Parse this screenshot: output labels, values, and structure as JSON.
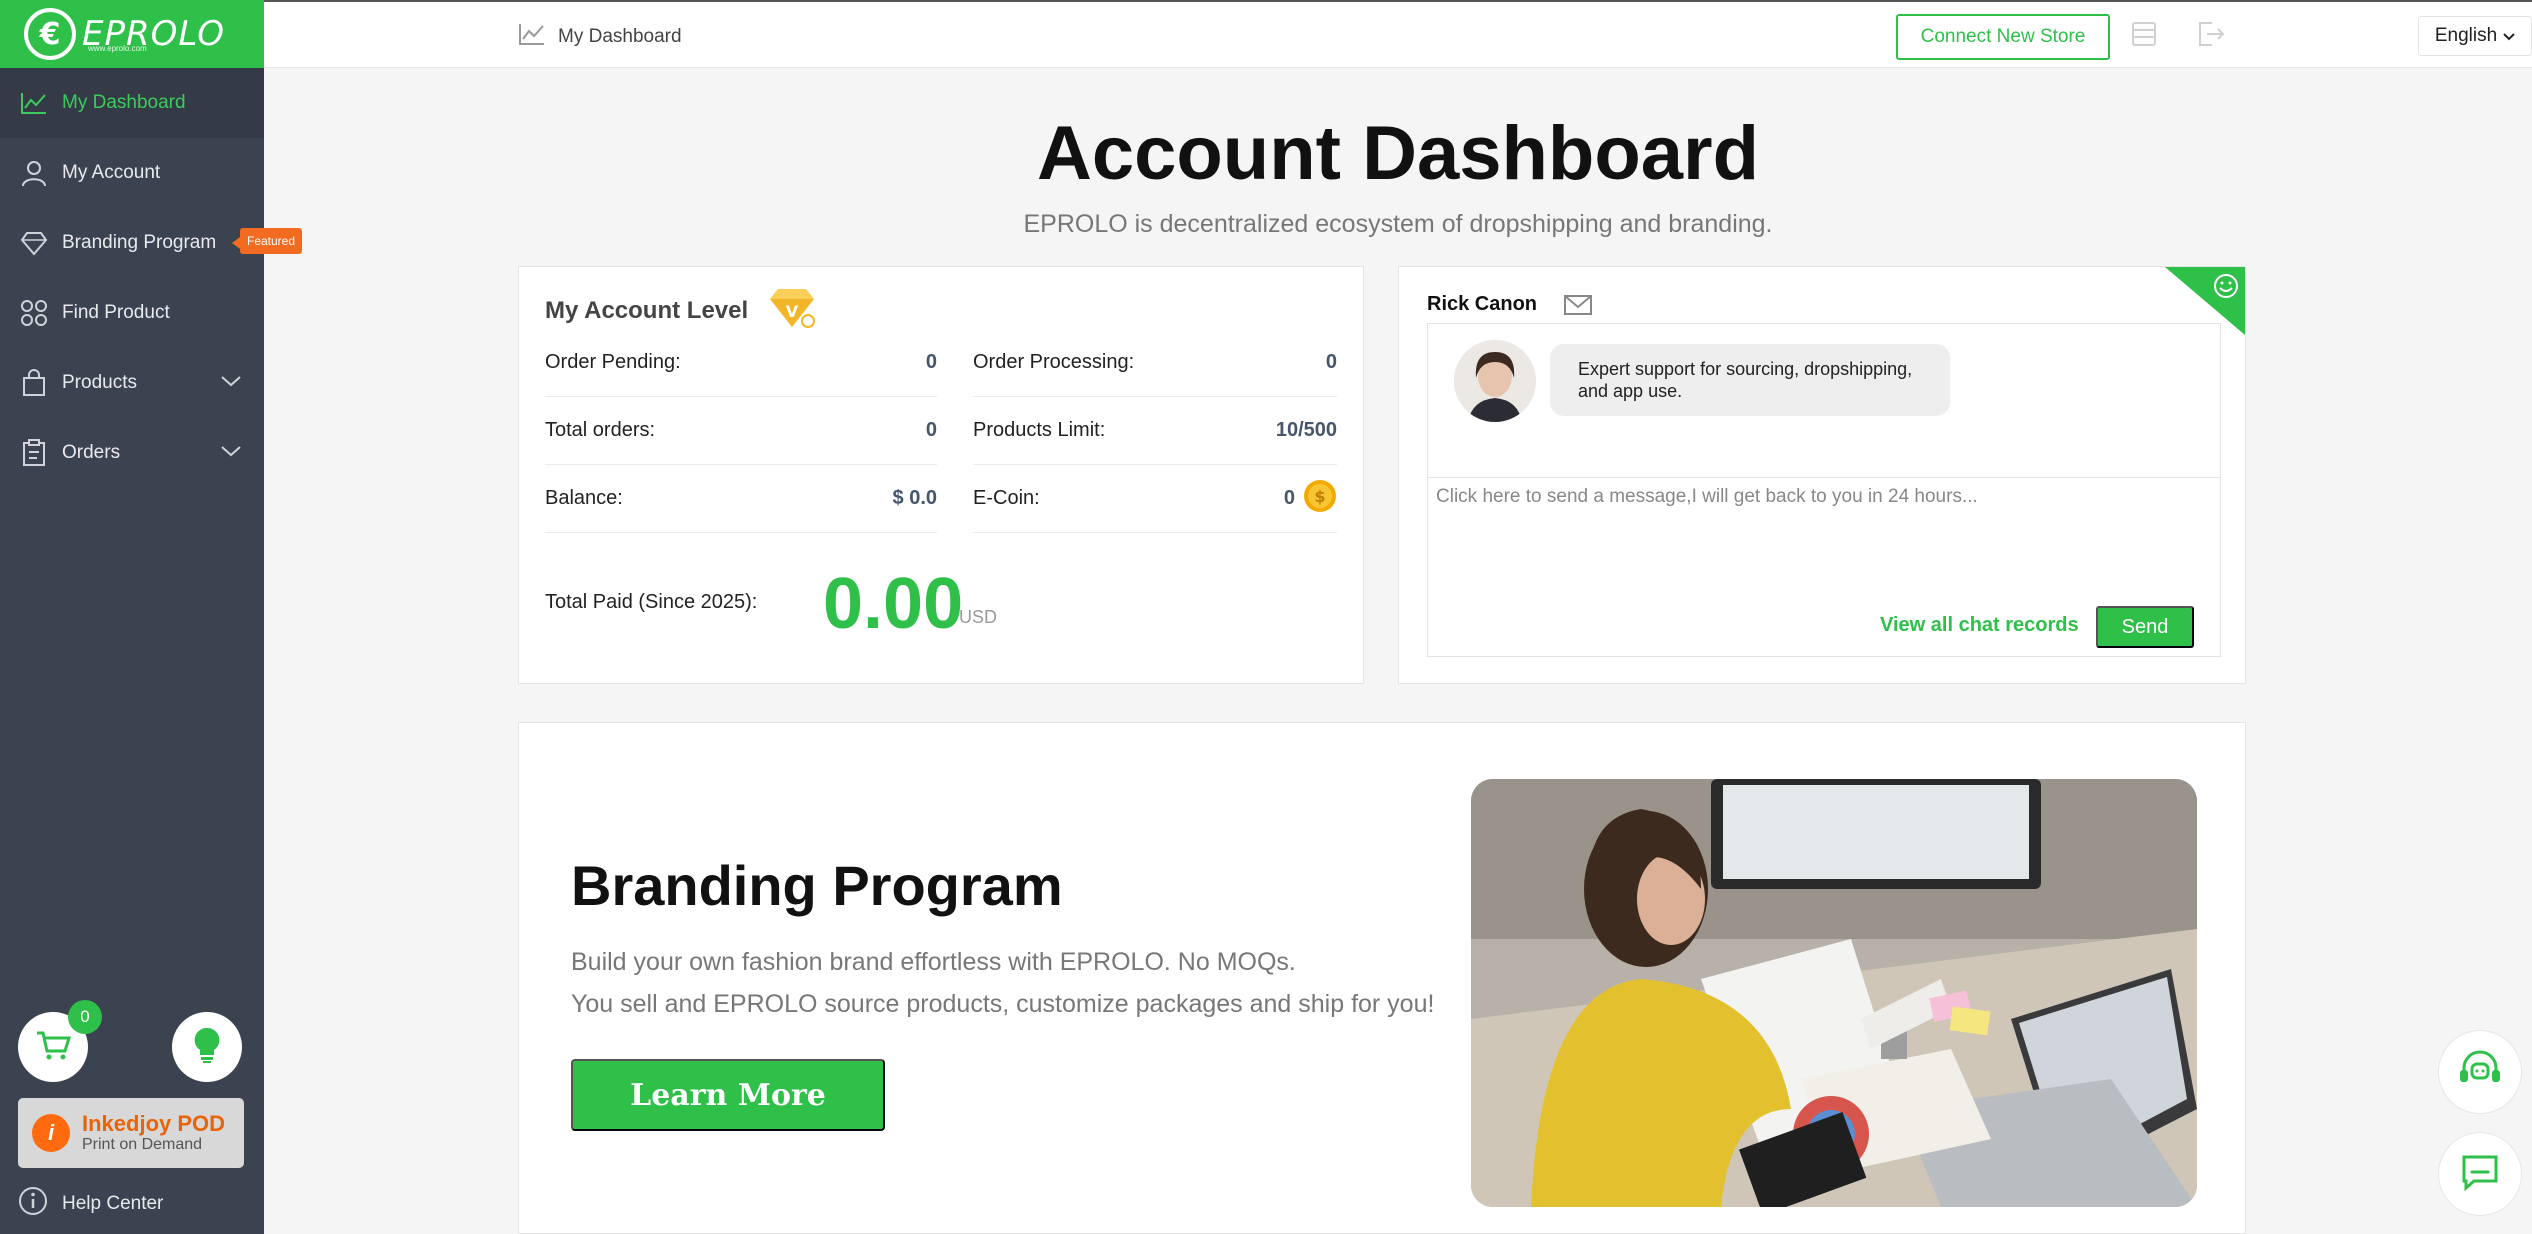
{
  "brand": {
    "logo_text": "EPROLO",
    "logo_sub": "www.eprolo.com"
  },
  "sidebar": {
    "items": [
      {
        "label": "My Dashboard",
        "icon": "chart-line-icon",
        "active": true
      },
      {
        "label": "My Account",
        "icon": "user-icon"
      },
      {
        "label": "Branding Program",
        "icon": "diamond-icon",
        "badge": "Featured"
      },
      {
        "label": "Find Product",
        "icon": "grid-icon"
      },
      {
        "label": "Products",
        "icon": "bag-icon",
        "expandable": true
      },
      {
        "label": "Orders",
        "icon": "clipboard-icon",
        "expandable": true
      }
    ],
    "cart_count": "0",
    "pod": {
      "title": "Inkedjoy POD",
      "subtitle": "Print on Demand"
    },
    "help": "Help Center"
  },
  "topbar": {
    "breadcrumb": "My Dashboard",
    "connect_label": "Connect New Store",
    "language": "English"
  },
  "page": {
    "title": "Account Dashboard",
    "subtitle": "EPROLO is decentralized ecosystem of dropshipping and branding."
  },
  "account": {
    "title": "My Account Level",
    "order_pending_label": "Order Pending:",
    "order_pending": "0",
    "order_processing_label": "Order Processing:",
    "order_processing": "0",
    "total_orders_label": "Total orders:",
    "total_orders": "0",
    "products_limit_label": "Products Limit:",
    "products_limit": "10/500",
    "balance_label": "Balance:",
    "balance": "$ 0.0",
    "ecoin_label": "E-Coin:",
    "ecoin": "0",
    "total_paid_label": "Total Paid (Since 2025):",
    "total_paid": "0.00",
    "currency": "USD"
  },
  "chat": {
    "agent": "Rick Canon",
    "message": "Expert support for sourcing, dropshipping, and app use.",
    "placeholder": "Click here to send a message,I will get back to you in 24 hours...",
    "view_all": "View all chat records",
    "send": "Send"
  },
  "branding": {
    "title": "Branding Program",
    "line1": "Build your own fashion brand effortless with EPROLO. No MOQs.",
    "line2": "You sell and EPROLO source products, customize packages and ship for you!",
    "button": "Learn More"
  },
  "colors": {
    "accent": "#2fc04a",
    "sidebar": "#3b4350",
    "badge": "#f26b21"
  }
}
